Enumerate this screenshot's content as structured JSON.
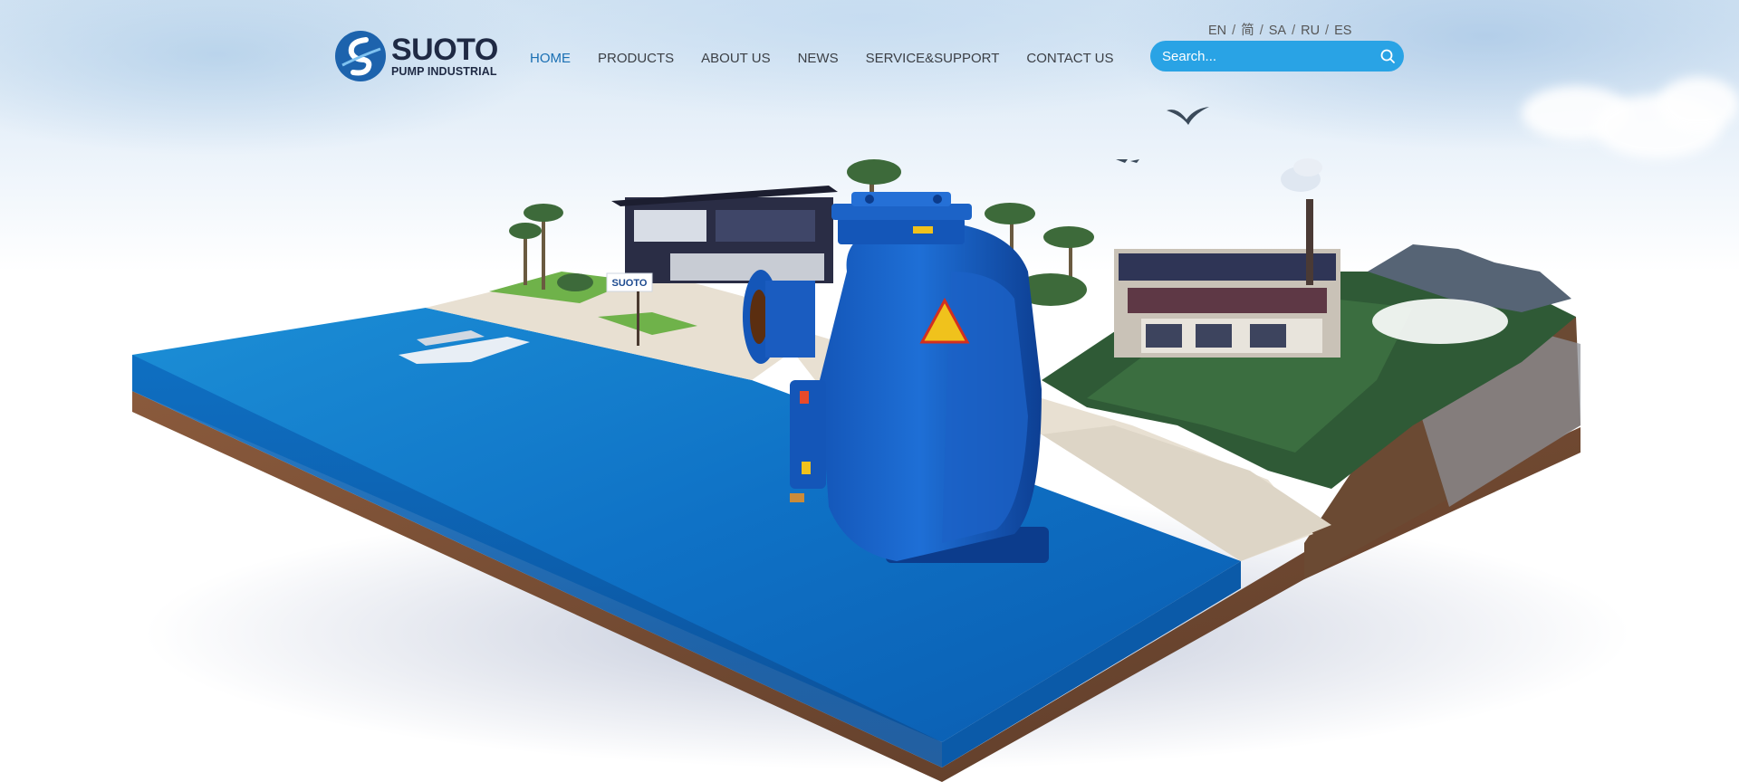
{
  "brand": {
    "name": "SUOTO",
    "tagline": "PUMP INDUSTRIAL",
    "primary_color": "#1d63ad",
    "dark_color": "#1f2a44"
  },
  "nav": {
    "items": [
      {
        "label": "HOME",
        "active": true
      },
      {
        "label": "PRODUCTS",
        "active": false
      },
      {
        "label": "ABOUT US",
        "active": false
      },
      {
        "label": "NEWS",
        "active": false
      },
      {
        "label": "SERVICE&SUPPORT",
        "active": false
      },
      {
        "label": "CONTACT US",
        "active": false
      }
    ],
    "active_color": "#1a6fb3"
  },
  "languages": [
    "EN",
    "简",
    "SA",
    "RU",
    "ES"
  ],
  "language_separator": "/",
  "search": {
    "placeholder": "Search...",
    "icon": "search-icon",
    "color": "#29a3e5"
  },
  "hero": {
    "sign_text": "SUOTO"
  }
}
